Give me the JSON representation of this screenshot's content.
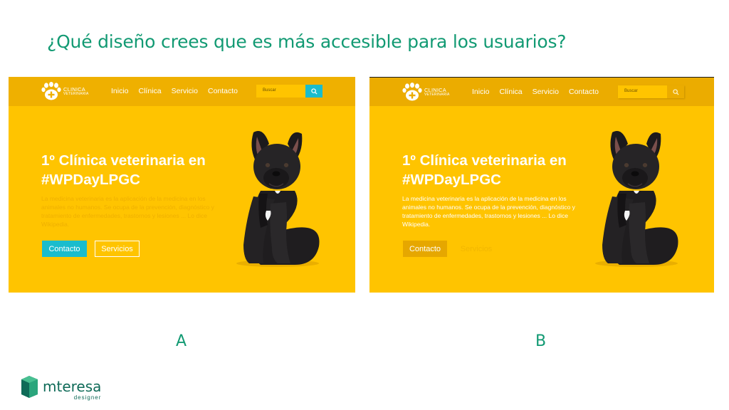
{
  "question": "¿Qué diseño crees que es más accesible para los usuarios?",
  "mockups": [
    {
      "label": "A",
      "logo_line1": "CLINICA",
      "logo_line2": "VETERINARIA",
      "nav": [
        "Inicio",
        "Clínica",
        "Servicio",
        "Contacto"
      ],
      "search_placeholder": "Buscar",
      "hero_title": "1º Clínica veterinaria en #WPDayLPGC",
      "hero_desc": "La medicina veterinaria es la aplicación de la medicina en los animales no humanos. Se ocupa de la prevención, diagnóstico y tratamiento de enfermedades, trastornos y lesiones ... Lo dice Wikipedia.",
      "btn_contact": "Contacto",
      "btn_services": "Servicios"
    },
    {
      "label": "B",
      "logo_line1": "CLINICA",
      "logo_line2": "VETERINARIA",
      "nav": [
        "Inicio",
        "Clínica",
        "Servicio",
        "Contacto"
      ],
      "search_placeholder": "Buscar",
      "hero_title": "1º Clínica veterinaria en #WPDayLPGC",
      "hero_desc": "La medicina veterinaria es la aplicación de la medicina en los animales no humanos. Se ocupa de la prevención, diagnóstico y tratamiento de enfermedades, trastornos y lesiones ... Lo dice Wikipedia.",
      "btn_contact": "Contacto",
      "btn_services": "Servicios"
    }
  ],
  "brand": {
    "name": "mteresa",
    "subtitle": "designer"
  },
  "colors": {
    "accent_green": "#129a73",
    "mock_yellow": "#ffc400",
    "mock_nav": "#efb000",
    "button_cyan": "#1abccd"
  }
}
